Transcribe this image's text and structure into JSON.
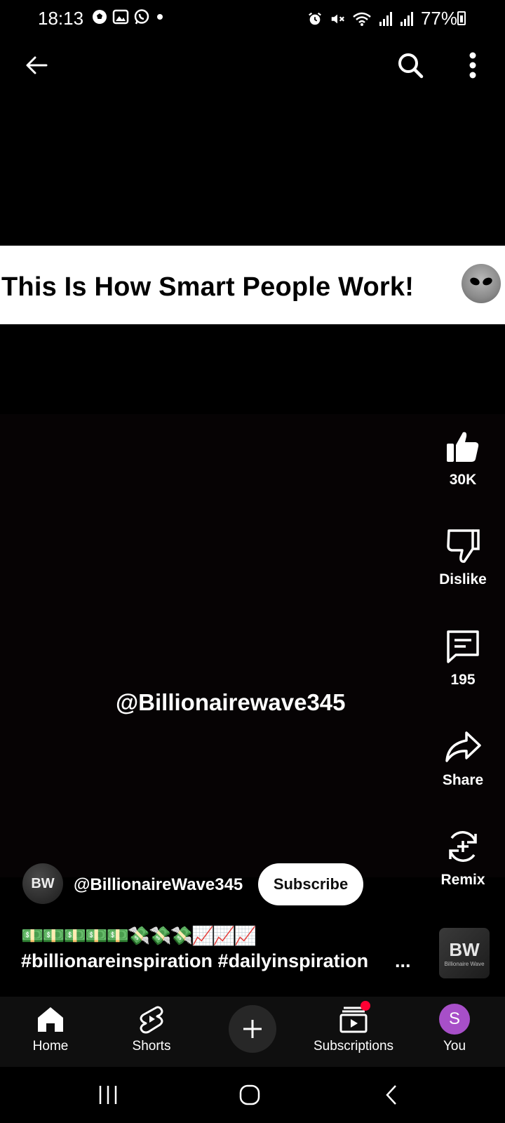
{
  "status_bar": {
    "time": "18:13",
    "battery": "77%",
    "left_icons": [
      "soccer-ball-icon",
      "gallery-icon",
      "whatsapp-icon",
      "dot-icon"
    ],
    "right_icons": [
      "alarm-icon",
      "mute-icon",
      "wifi-icon",
      "signal-icon",
      "signal-icon",
      "battery-icon"
    ]
  },
  "top_bar": {
    "back_icon": "arrow-left-icon",
    "search_icon": "search-icon",
    "more_icon": "more-vertical-icon"
  },
  "video": {
    "title": "This Is How Smart People Work!",
    "watermark": "@Billionairewave345"
  },
  "actions": {
    "like": {
      "label": "30K",
      "icon": "thumbs-up-icon"
    },
    "dislike": {
      "label": "Dislike",
      "icon": "thumbs-down-icon"
    },
    "comments": {
      "label": "195",
      "icon": "comment-icon"
    },
    "share": {
      "label": "Share",
      "icon": "share-icon"
    },
    "remix": {
      "label": "Remix",
      "icon": "remix-icon"
    }
  },
  "channel": {
    "avatar_text": "BW",
    "handle": "@BillionaireWave345",
    "subscribe_label": "Subscribe"
  },
  "description": {
    "emojis": "💵💵💵💵💵💸💸💸📈📈📈",
    "hashtags": "#billionareinspiration #dailyinspiration",
    "more": "..."
  },
  "sound_thumb": {
    "logo": "BW",
    "caption": "Billionaire Wave"
  },
  "bottom_nav": {
    "home": "Home",
    "shorts": "Shorts",
    "subscriptions": "Subscriptions",
    "you": "You",
    "you_initial": "S"
  },
  "colors": {
    "background": "#000000",
    "nav_bg": "#0f0f0f",
    "notification": "#ff0033",
    "you_avatar": "#a74fc8"
  }
}
